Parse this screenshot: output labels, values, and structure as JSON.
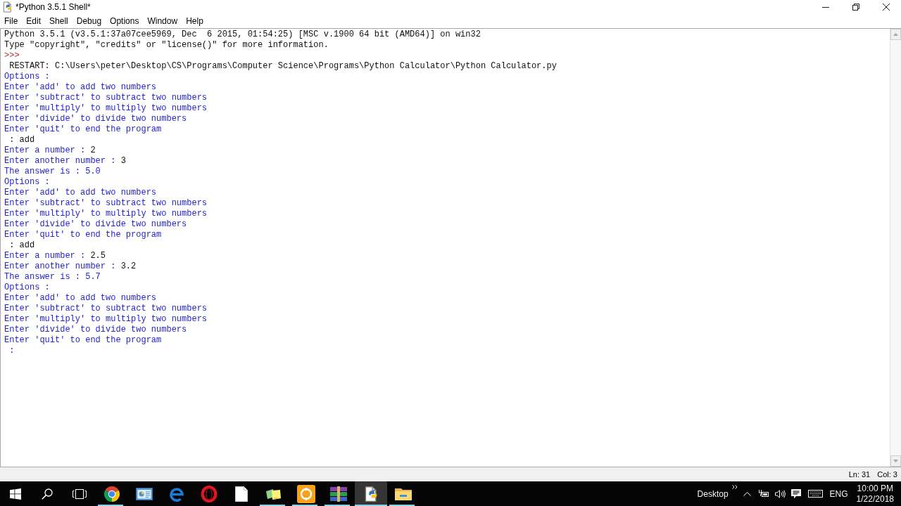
{
  "window": {
    "title": "*Python 3.5.1 Shell*"
  },
  "menu": [
    "File",
    "Edit",
    "Shell",
    "Debug",
    "Options",
    "Window",
    "Help"
  ],
  "shell": {
    "lines": [
      {
        "kind": "console",
        "text": "Python 3.5.1 (v3.5.1:37a07cee5969, Dec  6 2015, 01:54:25) [MSC v.1900 64 bit (AMD64)] on win32"
      },
      {
        "kind": "console",
        "text": "Type \"copyright\", \"credits\" or \"license()\" for more information."
      },
      {
        "kind": "prompt",
        "text": ">>> "
      },
      {
        "kind": "console",
        "text": " RESTART: C:\\Users\\peter\\Desktop\\CS\\Programs\\Computer Science\\Programs\\Python Calculator\\Python Calculator.py"
      },
      {
        "kind": "stdout",
        "text": "Options :"
      },
      {
        "kind": "stdout",
        "text": "Enter 'add' to add two numbers"
      },
      {
        "kind": "stdout",
        "text": "Enter 'subtract' to subtract two numbers"
      },
      {
        "kind": "stdout",
        "text": "Enter 'multiply' to multiply two numbers"
      },
      {
        "kind": "stdout",
        "text": "Enter 'divide' to divide two numbers"
      },
      {
        "kind": "stdout",
        "text": "Enter 'quit' to end the program"
      },
      {
        "kind": "stdin",
        "text": " : add"
      },
      {
        "kind": "stdout",
        "text": "Enter a number : ",
        "input": "2"
      },
      {
        "kind": "stdout",
        "text": "Enter another number : ",
        "input": "3"
      },
      {
        "kind": "stdout",
        "text": "The answer is : 5.0"
      },
      {
        "kind": "stdout",
        "text": "Options :"
      },
      {
        "kind": "stdout",
        "text": "Enter 'add' to add two numbers"
      },
      {
        "kind": "stdout",
        "text": "Enter 'subtract' to subtract two numbers"
      },
      {
        "kind": "stdout",
        "text": "Enter 'multiply' to multiply two numbers"
      },
      {
        "kind": "stdout",
        "text": "Enter 'divide' to divide two numbers"
      },
      {
        "kind": "stdout",
        "text": "Enter 'quit' to end the program"
      },
      {
        "kind": "stdin",
        "text": " : add"
      },
      {
        "kind": "stdout",
        "text": "Enter a number : ",
        "input": "2.5"
      },
      {
        "kind": "stdout",
        "text": "Enter another number : ",
        "input": "3.2"
      },
      {
        "kind": "stdout",
        "text": "The answer is : 5.7"
      },
      {
        "kind": "stdout",
        "text": "Options :"
      },
      {
        "kind": "stdout",
        "text": "Enter 'add' to add two numbers"
      },
      {
        "kind": "stdout",
        "text": "Enter 'subtract' to subtract two numbers"
      },
      {
        "kind": "stdout",
        "text": "Enter 'multiply' to multiply two numbers"
      },
      {
        "kind": "stdout",
        "text": "Enter 'divide' to divide two numbers"
      },
      {
        "kind": "stdout",
        "text": "Enter 'quit' to end the program"
      },
      {
        "kind": "stdout",
        "text": " :"
      }
    ]
  },
  "status_bar": {
    "line": "Ln: 31",
    "column": "Col: 3"
  },
  "taskbar": {
    "buttons": [
      {
        "kind": "start"
      },
      {
        "kind": "search"
      },
      {
        "kind": "task_view"
      }
    ],
    "apps": [
      {
        "kind": "round_browser",
        "running": true,
        "selected": false
      },
      {
        "kind": "picture_app",
        "running": false,
        "selected": false
      },
      {
        "kind": "swirl_browser",
        "running": false,
        "selected": false
      },
      {
        "kind": "ring_browser",
        "running": false,
        "selected": false
      },
      {
        "kind": "document",
        "running": false,
        "selected": false
      },
      {
        "kind": "sticky_notes",
        "running": true,
        "selected": false
      },
      {
        "kind": "coin",
        "running": true,
        "selected": false
      },
      {
        "kind": "archive",
        "running": true,
        "selected": false
      },
      {
        "kind": "idle",
        "running": true,
        "selected": true
      },
      {
        "kind": "folder",
        "running": true,
        "selected": false
      }
    ]
  },
  "tray": {
    "desktop_label": "Desktop",
    "language": "ENG",
    "time": "10:00 PM",
    "date": "1/22/2018"
  }
}
